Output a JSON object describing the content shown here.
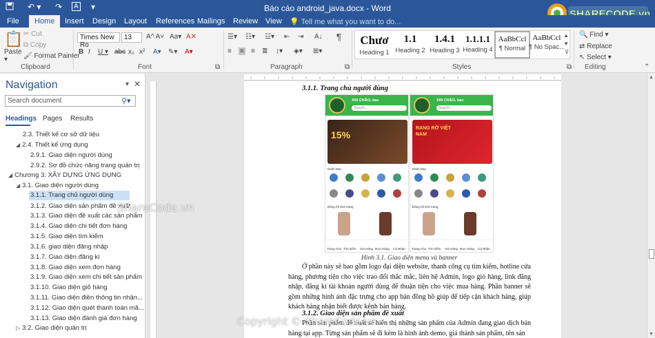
{
  "window": {
    "title": "Báo cáo android_java.docx - Word"
  },
  "quick_access": [
    "save-icon",
    "undo-icon",
    "redo-icon",
    "format-icon"
  ],
  "brand": {
    "logo_text": "SHARECODE.vn"
  },
  "tabs": [
    "File",
    "Home",
    "Insert",
    "Design",
    "Layout",
    "References",
    "Mailings",
    "Review",
    "View"
  ],
  "tell_me": "Tell me what you want to do...",
  "ribbon": {
    "clipboard": {
      "paste": "Paste",
      "cut": "Cut",
      "copy": "Copy",
      "format_painter": "Format Painter",
      "label": "Clipboard"
    },
    "font": {
      "family": "Times New Ro",
      "size": "13",
      "label": "Font"
    },
    "paragraph": {
      "label": "Paragraph"
    },
    "styles": {
      "label": "Styles",
      "items": [
        {
          "preview": "Chươ",
          "name": "Heading 1"
        },
        {
          "preview": "1.1",
          "name": "Heading 2"
        },
        {
          "preview": "1.4.1",
          "name": "Heading 3"
        },
        {
          "preview": "1.1.1.1",
          "name": "Heading 4"
        },
        {
          "preview": "AaBbCcl",
          "name": "¶ Normal"
        },
        {
          "preview": "AaBbCcl",
          "name": "¶ No Spac..."
        }
      ]
    },
    "editing": {
      "find": "Find",
      "replace": "Replace",
      "select": "Select",
      "label": "Editing"
    }
  },
  "navigation": {
    "title": "Navigation",
    "search_placeholder": "Search document",
    "tabs": [
      "Headings",
      "Pages",
      "Results"
    ],
    "items": [
      {
        "text": "2.3. Thiết kế cơ sở dữ liệu",
        "level": 2
      },
      {
        "text": "2.4. Thiết kế ứng dụng",
        "level": 1
      },
      {
        "text": "2.9.1. Giao diện người dùng",
        "level": 3
      },
      {
        "text": "2.9.2. Sơ đồ chức năng trang quản trị",
        "level": 3
      },
      {
        "text": "Chương 3. XÂY DỰNG ỨNG DỤNG",
        "level": 0
      },
      {
        "text": "3.1. Giao diện người dùng",
        "level": 1
      },
      {
        "text": "3.1.1. Trang chủ người dùng",
        "level": 3,
        "selected": true
      },
      {
        "text": "3.1.2. Giao diện sản phẩm đề xuất",
        "level": 3
      },
      {
        "text": "3.1.3. Giao diện đề xuất các sản phẩm",
        "level": 3
      },
      {
        "text": "3.1.4. Giao diện chi tiết đơn hàng",
        "level": 3
      },
      {
        "text": "3.1.5. Giao diện tìm kiếm",
        "level": 3
      },
      {
        "text": "3.1.6. giao diện đăng nhập",
        "level": 3
      },
      {
        "text": "3.1.7. Giao diện đăng kí",
        "level": 3
      },
      {
        "text": "3.1.8. Giao diện xem đơn hàng",
        "level": 3
      },
      {
        "text": "3.1.9. Giao diện xem chi tiết sản phẩm",
        "level": 3
      },
      {
        "text": "3.1.10. Giao diện giỏ hàng",
        "level": 3
      },
      {
        "text": "3.1.11. Giao diện điền thông tin nhận...",
        "level": 3
      },
      {
        "text": "3.1.12. Giao diện quét thanh toán mã...",
        "level": 3
      },
      {
        "text": "3.1.13. Giao diện đánh giá đơn hàng",
        "level": 3
      },
      {
        "text": "3.2. Giao diện quản trị",
        "level": 1
      }
    ]
  },
  "document": {
    "heading1": "3.1.1. Trang chủ người dùng",
    "phone": {
      "greeting": "XIN CHÀO, bac",
      "search": "Search...",
      "banner_left": "15%",
      "banner_right": "RANG RỠ VIỆT NAM",
      "section_1": "Danh Mục",
      "section_2": "Đồng hồ thời trang",
      "bottom_nav": [
        "Trang Chủ",
        "Tìm kiếm",
        "Giỏ Hàng",
        "Đơn Hàng",
        "Cá Nhân"
      ]
    },
    "caption": "Hình 3.1. Giao diện menu và banner",
    "para1": "Ở phần này sẽ bao gồm logo đại diện website, thanh công cụ tìm kiếm, hotline cửa hàng, phương tiện cho việc trao đổi thắc mắc, liên hệ Admin, logo giỏ hàng, link đăng nhập, đăng kí tài khoản người dùng để thuận tiện cho việc mua hàng. Phần banner sẽ gồm những hình ảnh đặc trưng cho app bán đồng hồ giúp để tiếp cận khách hàng, giúp khách hàng nhận biết được kênh bán hàng.",
    "heading2": "3.1.2. Giao diện sản phẩm đề xuất",
    "para2": "Phần sản phẩm đề xuất sẽ hiển thị những sản phẩm của Admin đang giao dịch bán hàng tại app. Từng sản phẩm sẽ đi kèm là hình ảnh demo, giá thành sản phẩm, tên sản"
  },
  "watermarks": [
    "ShareCode.vn",
    "Copyright © ShareCode.vn"
  ],
  "colors": {
    "ribbon_blue": "#2b579a",
    "app_green": "#3bb54a"
  }
}
